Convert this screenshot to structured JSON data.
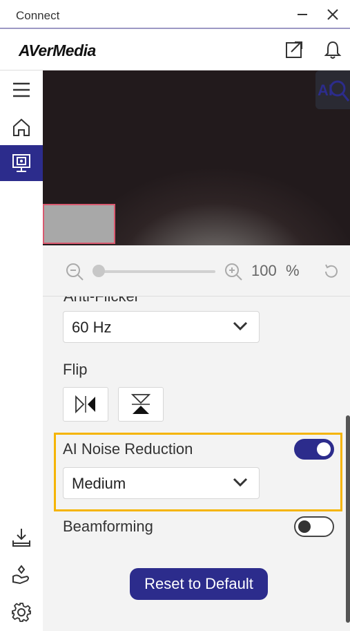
{
  "window": {
    "title": "Connect"
  },
  "header": {
    "logo": "AVerMedia"
  },
  "sidebar": {
    "items": [
      {
        "name": "menu",
        "icon": "hamburger-menu-icon"
      },
      {
        "name": "home",
        "icon": "home-icon"
      },
      {
        "name": "camera",
        "icon": "camera-monitor-icon",
        "active": true
      },
      {
        "name": "download",
        "icon": "download-icon"
      },
      {
        "name": "plugin",
        "icon": "plugin-icon"
      },
      {
        "name": "settings",
        "icon": "gear-icon"
      }
    ]
  },
  "preview": {
    "ai_button": "AI"
  },
  "zoom": {
    "value": "100",
    "unit": "%",
    "level": 0
  },
  "settings": {
    "anti_flicker_label": "Anti-Flicker",
    "anti_flicker_value": "60 Hz",
    "flip_label": "Flip",
    "ai_noise_label": "AI Noise Reduction",
    "ai_noise_enabled": true,
    "ai_noise_value": "Medium",
    "beamforming_label": "Beamforming",
    "beamforming_enabled": false,
    "reset_label": "Reset to Default"
  },
  "colors": {
    "accent": "#2c2c8c",
    "highlight": "#f5b400"
  }
}
